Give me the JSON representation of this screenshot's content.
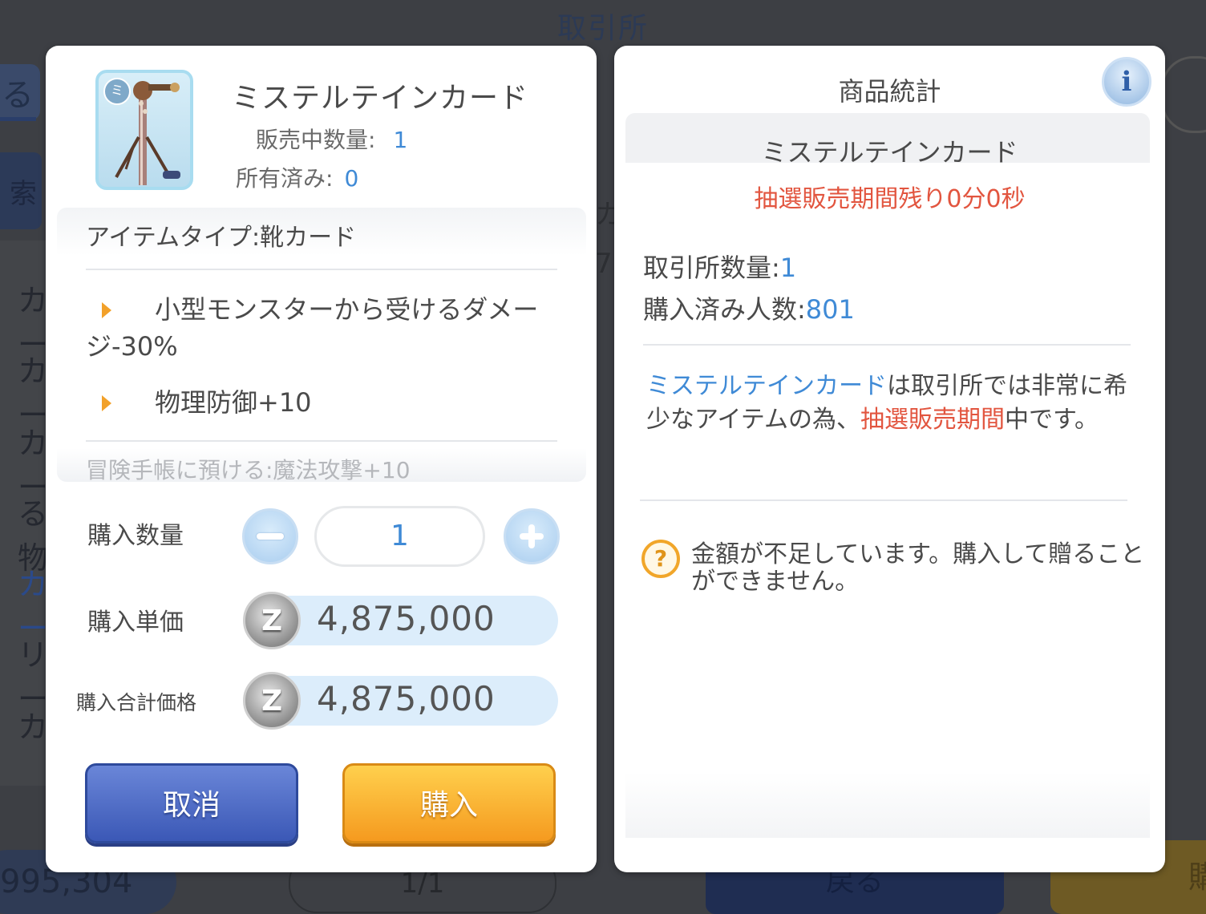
{
  "background": {
    "title": "取引所",
    "tab_glyph": "る",
    "search_glyph": "索",
    "list_items": [
      "カー",
      "カー",
      "カー",
      "る物",
      "カー",
      "リー",
      "カ"
    ],
    "mid_glyphs": [
      "カ",
      "7"
    ],
    "balance": "995,304",
    "page": "1/1",
    "back_label": "戻る",
    "buy_label": "購"
  },
  "left": {
    "item_name": "ミステルテインカード",
    "badge": "ミ",
    "on_sale_label": "販売中数量:",
    "on_sale_value": "1",
    "owned_label": "所有済み:",
    "owned_value": "0",
    "item_type": "アイテムタイプ:靴カード",
    "effects": [
      "小型モンスターから受けるダメー",
      "ジ-30%",
      "物理防御+10"
    ],
    "adventure_note": "冒険手帳に預ける:魔法攻撃+10",
    "qty_label": "購入数量",
    "qty_value": "1",
    "minus_symbol": "−",
    "plus_symbol": "+",
    "unit_price_label": "購入単価",
    "unit_price": "4,875,000",
    "total_label": "購入合計価格",
    "total_price": "4,875,000",
    "zeny_symbol": "Z",
    "cancel_label": "取消",
    "buy_label": "購入"
  },
  "right": {
    "title": "商品統計",
    "info_symbol": "i",
    "item_name": "ミステルテインカード",
    "lottery_remaining": "抽選販売期間残り0分0秒",
    "exchange_qty_label": "取引所数量:",
    "exchange_qty_value": "1",
    "purchased_label": "購入済み人数:",
    "purchased_value": "801",
    "notice_item": "ミステルテインカード",
    "notice_mid": "は取引所では非常に希少なアイテムの為、",
    "notice_period": "抽選販売期間",
    "notice_end": "中です。",
    "warn_symbol": "?",
    "warning": "金額が不足しています。購入して贈ることができません。"
  },
  "colors": {
    "accent_blue": "#3f8ad6",
    "alert_red": "#e2553f",
    "cancel_blue": "#3b58b6",
    "buy_orange": "#f59a1f"
  },
  "icons": {
    "item": "mistelteinn-card-icon",
    "minus": "minus-icon",
    "plus": "plus-icon",
    "zeny": "zeny-coin-icon",
    "info": "info-icon",
    "warning": "question-icon",
    "bullet": "triangle-bullet-icon"
  }
}
